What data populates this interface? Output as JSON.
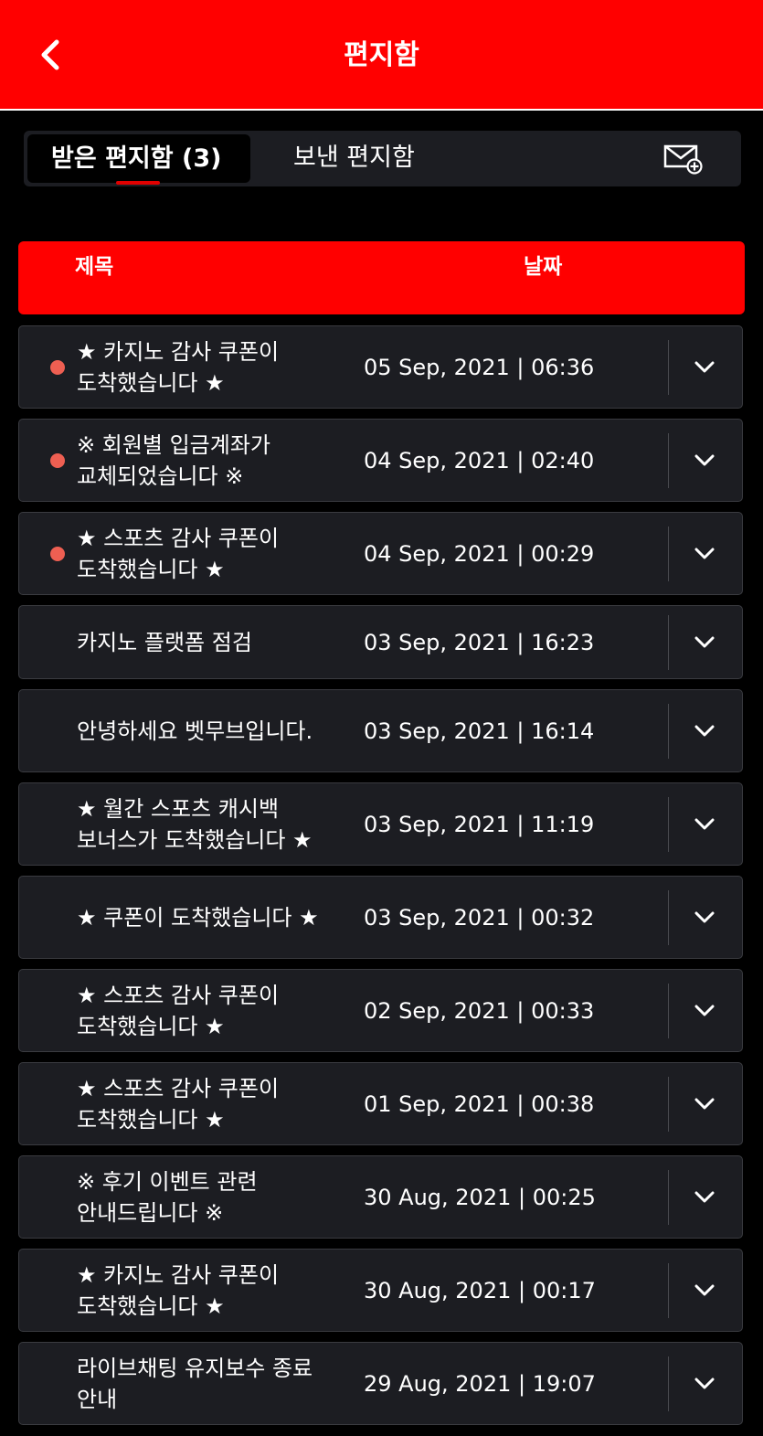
{
  "header": {
    "title": "편지함",
    "back_icon": "chevron-left-icon",
    "background": "#ff0000"
  },
  "tabs": {
    "inbox_label": "받은 편지함 (3)",
    "sent_label": "보낸 편지함",
    "compose_icon": "mail-add-icon"
  },
  "table": {
    "col_title": "제목",
    "col_date": "날짜"
  },
  "messages": [
    {
      "subject": "★ 카지노 감사 쿠폰이 도착했습니다 ★",
      "date": "05 Sep, 2021 | 06:36",
      "unread": true
    },
    {
      "subject": "※ 회원별 입금계좌가 교체되었습니다 ※",
      "date": "04 Sep, 2021 | 02:40",
      "unread": true
    },
    {
      "subject": "★ 스포츠 감사 쿠폰이 도착했습니다 ★",
      "date": "04 Sep, 2021 | 00:29",
      "unread": true
    },
    {
      "subject": "카지노 플랫폼 점검",
      "date": "03 Sep, 2021 | 16:23",
      "unread": false
    },
    {
      "subject": "안녕하세요 벳무브입니다.",
      "date": "03 Sep, 2021 | 16:14",
      "unread": false
    },
    {
      "subject": "★ 월간 스포츠 캐시백 보너스가 도착했습니다 ★",
      "date": "03 Sep, 2021 | 11:19",
      "unread": false
    },
    {
      "subject": "★ 쿠폰이 도착했습니다 ★",
      "date": "03 Sep, 2021 | 00:32",
      "unread": false
    },
    {
      "subject": "★ 스포츠 감사 쿠폰이 도착했습니다 ★",
      "date": "02 Sep, 2021 | 00:33",
      "unread": false
    },
    {
      "subject": "★ 스포츠 감사 쿠폰이 도착했습니다 ★",
      "date": "01 Sep, 2021 | 00:38",
      "unread": false
    },
    {
      "subject": "※ 후기 이벤트 관련 안내드립니다 ※",
      "date": "30 Aug, 2021 | 00:25",
      "unread": false
    },
    {
      "subject": "★ 카지노 감사 쿠폰이 도착했습니다 ★",
      "date": "30 Aug, 2021 | 00:17",
      "unread": false
    },
    {
      "subject": "라이브채팅 유지보수 종료 안내",
      "date": "29 Aug, 2021 | 19:07",
      "unread": false
    }
  ],
  "colors": {
    "accent": "#ff0000",
    "row_bg": "#1c1d22",
    "unread_dot": "#ee5f52"
  }
}
